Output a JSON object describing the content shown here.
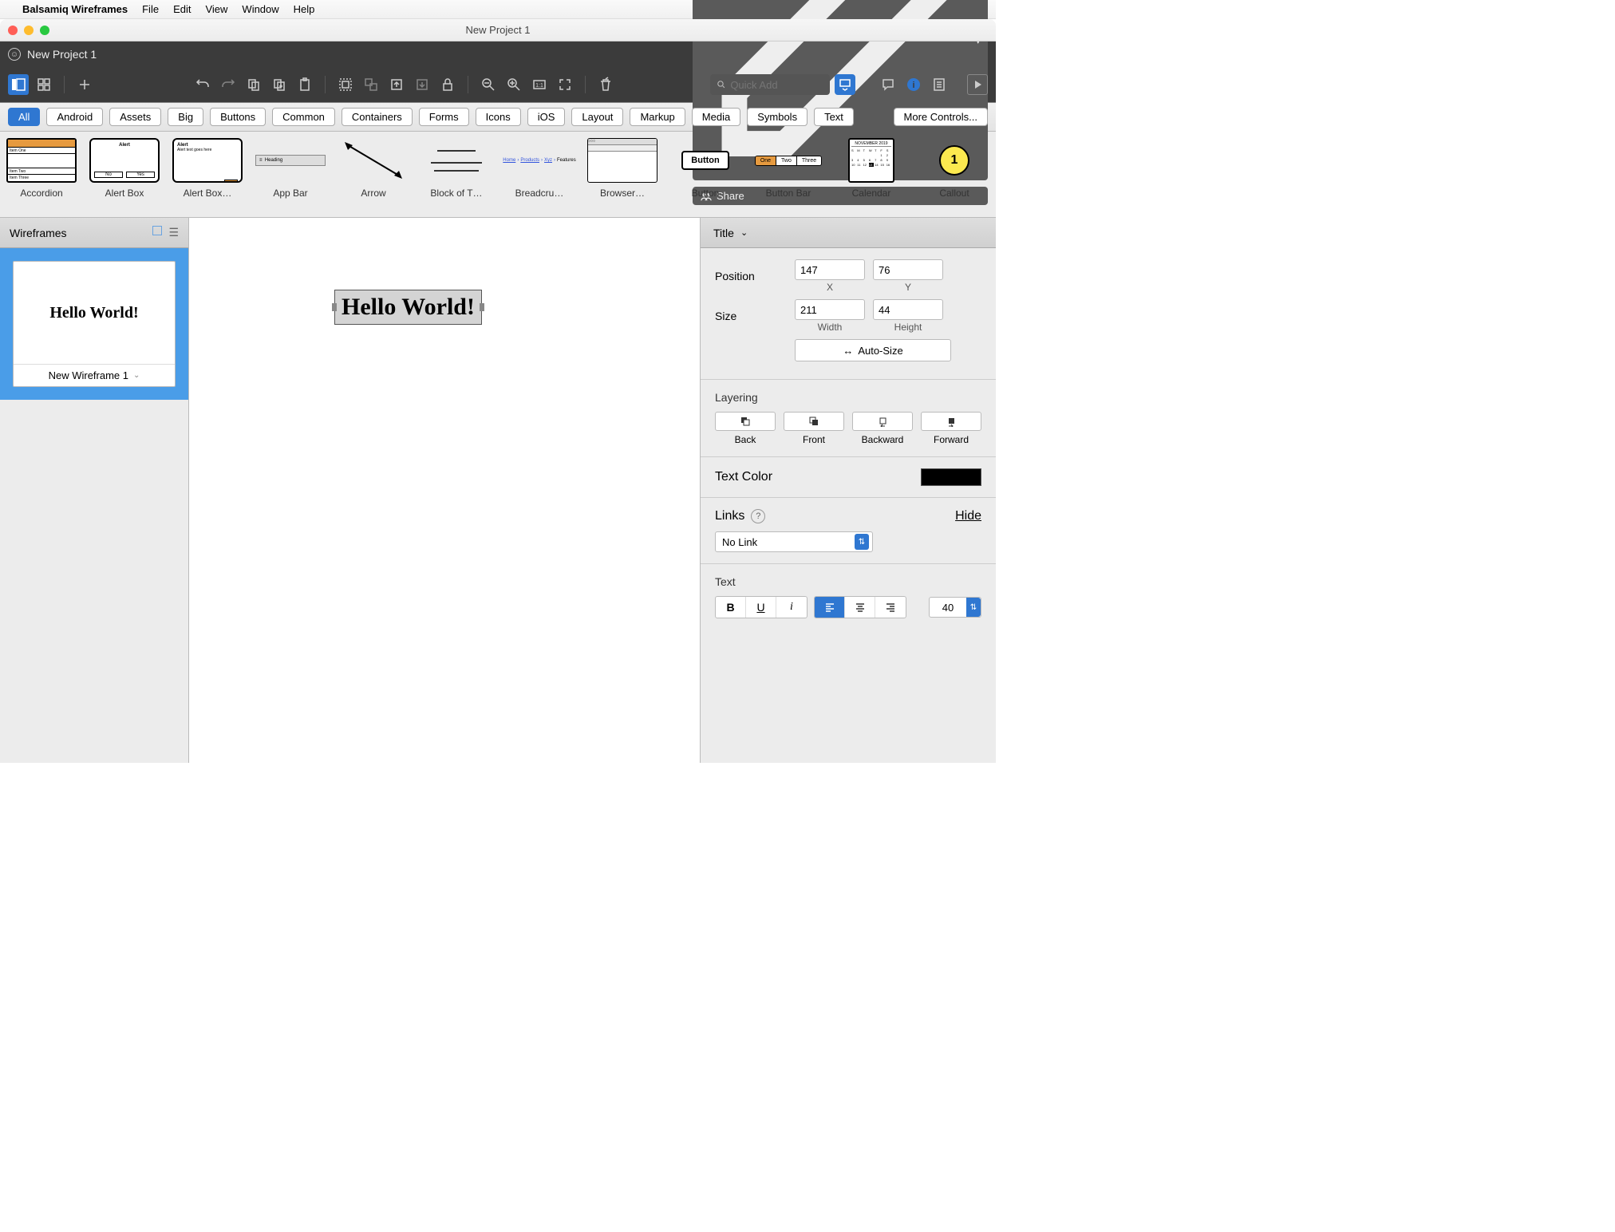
{
  "mac": {
    "app": "Balsamiq Wireframes",
    "menus": [
      "File",
      "Edit",
      "View",
      "Window",
      "Help"
    ]
  },
  "titlebar": {
    "title": "New Project 1"
  },
  "tab": {
    "name": "New Project 1"
  },
  "topbtns": {
    "edit": "",
    "share": "Share"
  },
  "quickadd": {
    "placeholder": "Quick Add"
  },
  "categories": [
    "All",
    "Android",
    "Assets",
    "Big",
    "Buttons",
    "Common",
    "Containers",
    "Forms",
    "Icons",
    "iOS",
    "Layout",
    "Markup",
    "Media",
    "Symbols",
    "Text"
  ],
  "more": "More Controls...",
  "library": [
    "Accordion",
    "Alert Box",
    "Alert Box…",
    "App Bar",
    "Arrow",
    "Block of T…",
    "Breadcru…",
    "Browser…",
    "Button",
    "Button Bar",
    "Calendar",
    "Callout"
  ],
  "leftpanel": {
    "title": "Wireframes",
    "card_name": "New Wireframe 1",
    "preview": "Hello World!"
  },
  "canvas": {
    "text": "Hello World!"
  },
  "inspector": {
    "title": "Title",
    "position_lbl": "Position",
    "x": "147",
    "y": "76",
    "x_lbl": "X",
    "y_lbl": "Y",
    "size_lbl": "Size",
    "w": "211",
    "h": "44",
    "w_lbl": "Width",
    "h_lbl": "Height",
    "autosize": "Auto-Size",
    "layering": "Layering",
    "layer_btns": [
      "Back",
      "Front",
      "Backward",
      "Forward"
    ],
    "textcolor": "Text Color",
    "links": "Links",
    "hide": "Hide",
    "nolink": "No Link",
    "text": "Text",
    "fontsize": "40"
  }
}
